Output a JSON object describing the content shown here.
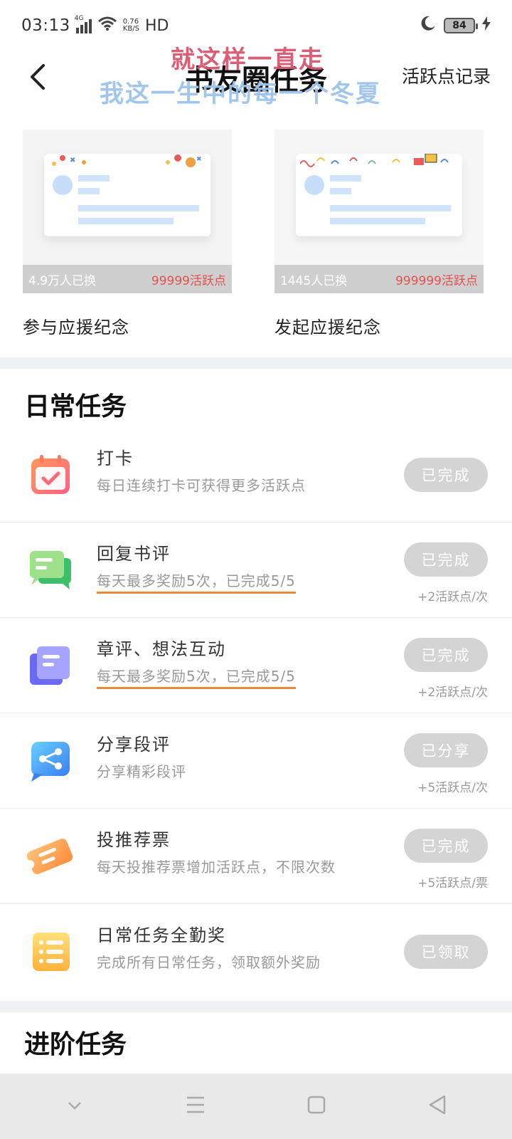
{
  "status_bar": {
    "time": "03:13",
    "network": "4G",
    "speed_value": "0.76",
    "speed_unit": "KB/S",
    "hd": "HD",
    "battery": "84"
  },
  "nav": {
    "title": "书友圈任务",
    "right_link": "活跃点记录",
    "overlay_line1": "就这样一直走",
    "overlay_line2": "我这一生中的每一个冬夏"
  },
  "rewards": [
    {
      "count": "4.9万人已换",
      "cost": "99999活跃点",
      "label": "参与应援纪念"
    },
    {
      "count": "1445人已换",
      "cost": "999999活跃点",
      "label": "发起应援纪念"
    }
  ],
  "daily": {
    "title": "日常任务",
    "tasks": [
      {
        "title": "打卡",
        "desc": "每日连续打卡可获得更多活跃点",
        "button": "已完成",
        "reward": ""
      },
      {
        "title": "回复书评",
        "desc": "每天最多奖励5次，已完成5/5",
        "button": "已完成",
        "reward": "+2活跃点/次"
      },
      {
        "title": "章评、想法互动",
        "desc": "每天最多奖励5次，已完成5/5",
        "button": "已完成",
        "reward": "+2活跃点/次"
      },
      {
        "title": "分享段评",
        "desc": "分享精彩段评",
        "button": "已分享",
        "reward": "+5活跃点/次"
      },
      {
        "title": "投推荐票",
        "desc": "每天投推荐票增加活跃点，不限次数",
        "button": "已完成",
        "reward": "+5活跃点/票"
      },
      {
        "title": "日常任务全勤奖",
        "desc": "完成所有日常任务，领取额外奖励",
        "button": "已领取",
        "reward": ""
      }
    ]
  },
  "advanced": {
    "title": "进阶任务"
  },
  "colors": {
    "accent_red": "#e5524e",
    "button_done": "#d4d4d4",
    "underline": "#e98a3a"
  }
}
